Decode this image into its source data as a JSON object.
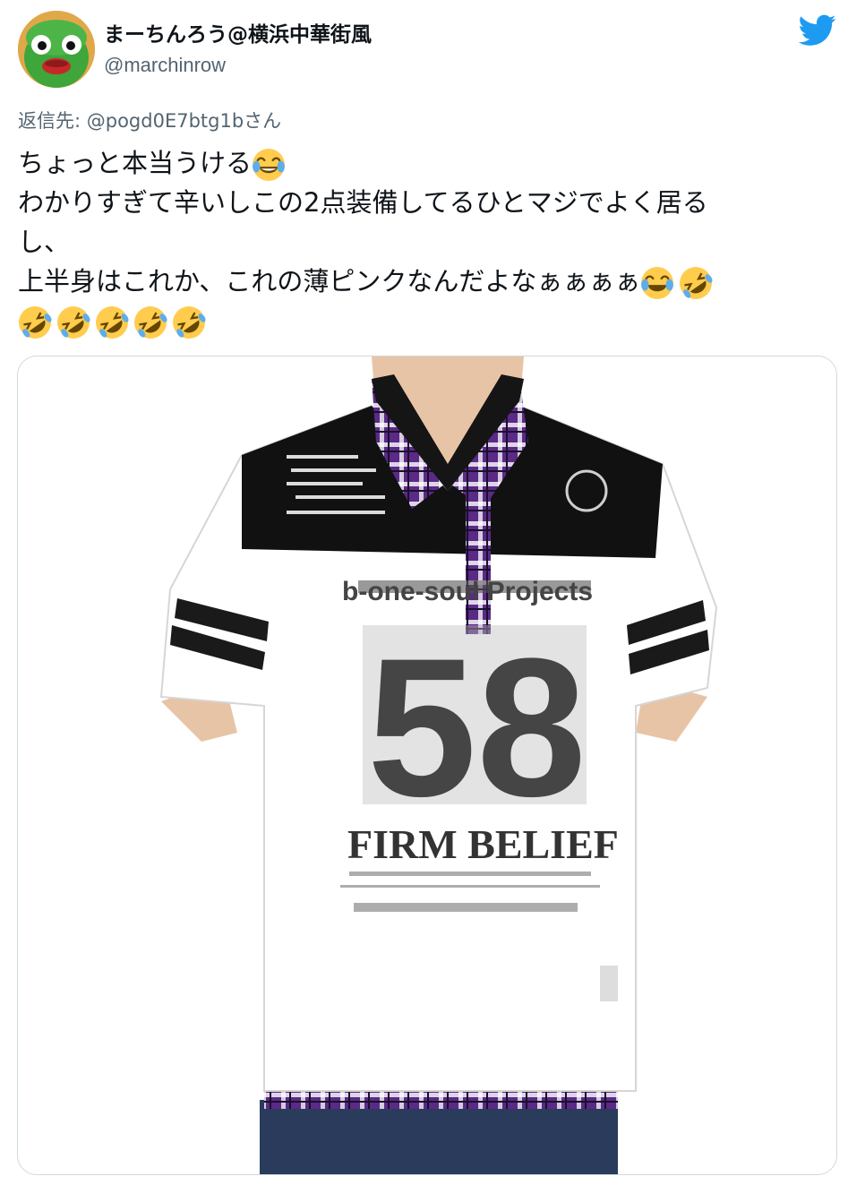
{
  "tweet": {
    "display_name": "まーちんろう@横浜中華街風",
    "handle": "@marchinrow",
    "reply_to": "返信先: @pogd0E7btg1bさん",
    "text_lines": {
      "l1": "ちょっと本当うける",
      "l2": "わかりすぎて辛いしこの2点装備してるひとマジでよく居る",
      "l3": "し、",
      "l4": "上半身はこれか、これの薄ピンクなんだよなぁぁぁぁ"
    },
    "icons": {
      "avatar": "avatar-image",
      "logo": "twitter-bird-icon",
      "emoji_tears": "face-with-tears-of-joy-emoji",
      "emoji_rofl": "rolling-on-the-floor-laughing-emoji"
    }
  },
  "media": {
    "description_icon": "photo",
    "shirt_texts": {
      "brand_line": "b-one-soul Projects",
      "number": "58",
      "slogan": "FIRM BELIEF"
    }
  },
  "colors": {
    "accent": "#1d9bf0",
    "secondary_text": "#536471",
    "border": "#cfd9de"
  }
}
